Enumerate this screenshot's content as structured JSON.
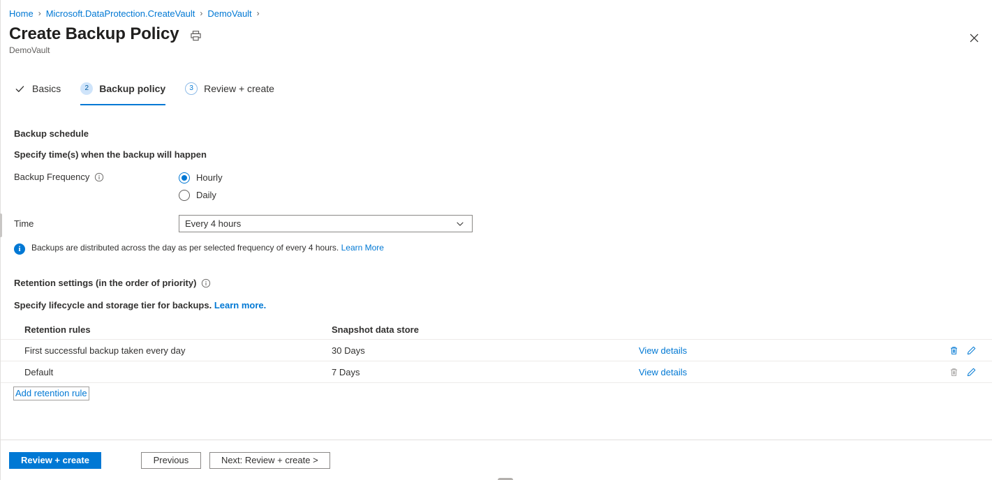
{
  "breadcrumb": {
    "items": [
      {
        "label": "Home"
      },
      {
        "label": "Microsoft.DataProtection.CreateVault"
      },
      {
        "label": "DemoVault"
      }
    ],
    "separator": "›"
  },
  "header": {
    "title": "Create Backup Policy",
    "subtitle": "DemoVault",
    "print_icon": "printer-icon",
    "close_icon": "close-icon",
    "close_label": "✕"
  },
  "tabs": [
    {
      "label": "Basics",
      "marker": "✓",
      "state": "completed"
    },
    {
      "label": "Backup policy",
      "marker": "2",
      "state": "active"
    },
    {
      "label": "Review + create",
      "marker": "3",
      "state": "upcoming"
    }
  ],
  "schedule": {
    "section_title": "Backup schedule",
    "description": "Specify time(s) when the backup will happen",
    "frequency_label": "Backup Frequency",
    "frequency_info_icon": "info-outline-icon",
    "frequency_options": [
      {
        "label": "Hourly",
        "selected": true
      },
      {
        "label": "Daily",
        "selected": false
      }
    ],
    "time_label": "Time",
    "time_value": "Every 4 hours",
    "time_chevron": "chevron-down-icon",
    "info_message": "Backups are distributed across the day as per selected frequency of every 4 hours.",
    "info_link": "Learn More",
    "info_icon": "info-filled-icon"
  },
  "retention": {
    "section_title": "Retention settings (in the order of priority)",
    "section_info_icon": "info-outline-icon",
    "description": "Specify lifecycle and storage tier for backups.",
    "description_link": "Learn more.",
    "columns": [
      "Retention rules",
      "Snapshot data store",
      "",
      ""
    ],
    "rows": [
      {
        "rule": "First successful backup taken every day",
        "store": "30 Days",
        "details_link": "View details",
        "delete_enabled": true,
        "edit_enabled": true
      },
      {
        "rule": "Default",
        "store": "7 Days",
        "details_link": "View details",
        "delete_enabled": false,
        "edit_enabled": true
      }
    ],
    "add_rule_label": "Add retention rule"
  },
  "footer": {
    "review_create": "Review + create",
    "previous": "Previous",
    "next": "Next: Review + create >"
  },
  "colors": {
    "accent": "#0078d4",
    "link": "#0078d4",
    "text": "#323130",
    "muted": "#605e5c",
    "border": "#edebe9",
    "disabled": "#a19f9d"
  }
}
